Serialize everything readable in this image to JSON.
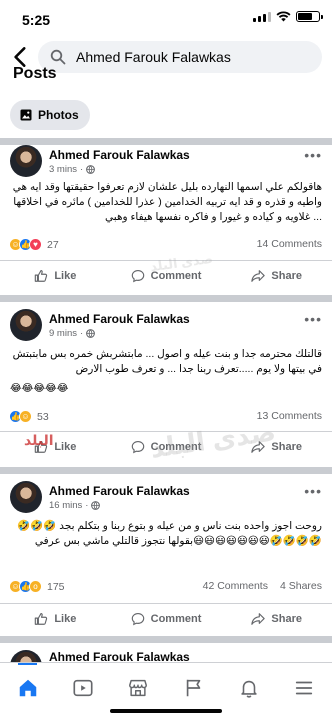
{
  "status_bar": {
    "time": "5:25",
    "signal_icon": "signal-bars-icon",
    "wifi_icon": "wifi-icon",
    "battery_icon": "battery-icon"
  },
  "search": {
    "query": "Ahmed Farouk Falawkas",
    "back_icon": "back-arrow-icon",
    "search_icon": "search-icon"
  },
  "section_title": "Posts",
  "filter_chip": {
    "label": "Photos",
    "icon": "photo-icon"
  },
  "posts": [
    {
      "author": "Ahmed Farouk Falawkas",
      "time": "3 mins",
      "text": "هاقولكم علي اسمها النهارده بليل علشان لازم تعرفوا حقيقتها وقد ايه هي واطيه و قذره و قد ايه تربيه الخدامين ( عذرا للخدامين ) مائره في اخلاقها ... غلاويه و كياده و غيورا و فاكره نفسها هيفاء وهبي",
      "reaction_count": "27",
      "comments": "14 Comments",
      "shares": "",
      "emoji": ""
    },
    {
      "author": "Ahmed Farouk Falawkas",
      "time": "9 mins",
      "text": "قالتلك محترمه جدا و بنت عيله و اصول ... مابتشربش خمره بس مابتبتش في بيتها ولا يوم .....تعرف ربنا جدا ... و تعرف طوب الارض",
      "reaction_count": "53",
      "comments": "13 Comments",
      "shares": "",
      "emoji": "😂😂😂😂😂"
    },
    {
      "author": "Ahmed Farouk Falawkas",
      "time": "16 mins",
      "text": "روحت اجوز واحده بنت ناس و من عيله و بتوع ربنا و بتكلم بجد 🤣🤣🤣🤣🤣🤣🤣😃😃😃😃😃😃😃بقولها نتجوز قالتلي ماشي بس عرفي",
      "reaction_count": "175",
      "comments": "42 Comments",
      "shares": "4 Shares",
      "emoji": ""
    }
  ],
  "next_post_author": "Ahmed Farouk Falawkas",
  "actions": {
    "like": "Like",
    "comment": "Comment",
    "share": "Share"
  },
  "watermarks": [
    "صدى البلد",
    "البلد"
  ],
  "bottom_nav": [
    "home-icon",
    "video-icon",
    "marketplace-icon",
    "flag-icon",
    "bell-icon",
    "menu-icon"
  ],
  "colors": {
    "accent": "#1877f2",
    "divider": "#c9ccd1",
    "secondary_text": "#65676b"
  }
}
